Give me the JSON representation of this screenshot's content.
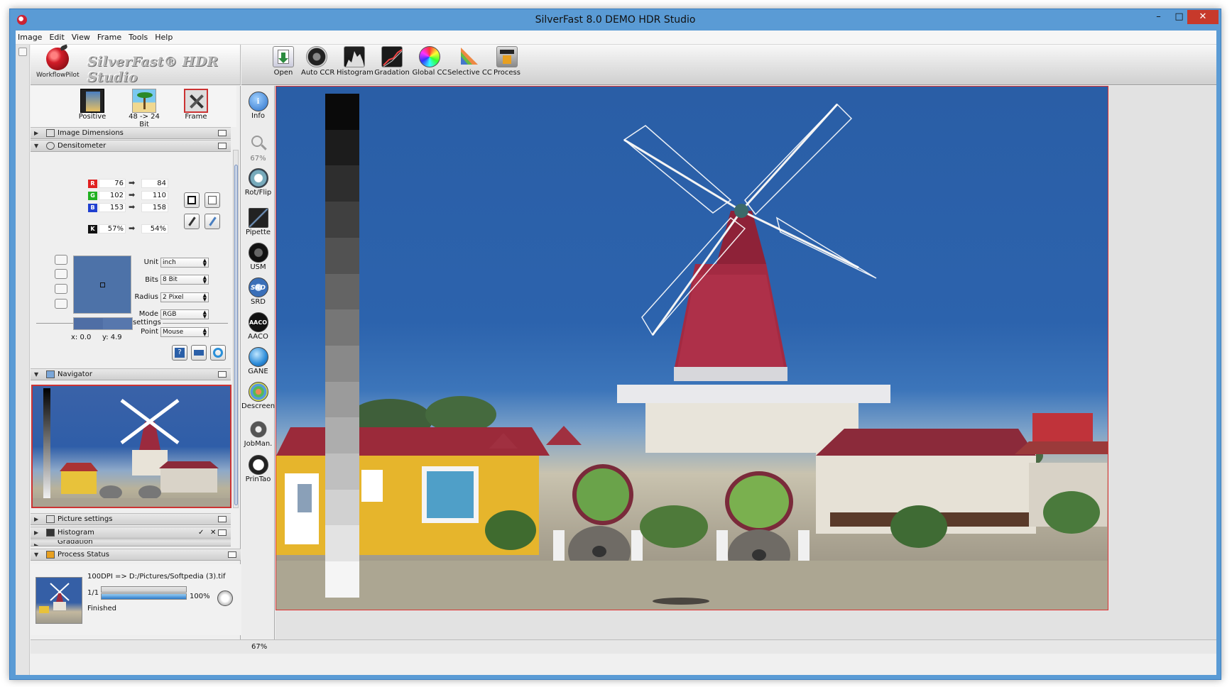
{
  "window": {
    "title": "SilverFast 8.0 DEMO  HDR Studio"
  },
  "menu": [
    "Image",
    "Edit",
    "View",
    "Frame",
    "Tools",
    "Help"
  ],
  "logo": {
    "workflow_pilot": "WorkflowPilot",
    "brand": "SilverFast® HDR Studio"
  },
  "toolbar": [
    {
      "label": "Open",
      "icon": "open-icon"
    },
    {
      "label": "Auto CCR",
      "icon": "auto-ccr-icon"
    },
    {
      "label": "Histogram",
      "icon": "histogram-icon"
    },
    {
      "label": "Gradation",
      "icon": "gradation-icon"
    },
    {
      "label": "Global CC",
      "icon": "global-cc-icon"
    },
    {
      "label": "Selective CC",
      "icon": "selective-cc-icon"
    },
    {
      "label": "Process",
      "icon": "process-icon"
    }
  ],
  "quick": [
    {
      "label": "Positive",
      "icon": "film-icon"
    },
    {
      "label": "48 -> 24 Bit",
      "icon": "beach-icon"
    },
    {
      "label": "Frame",
      "icon": "frame-tools-icon"
    }
  ],
  "sections": {
    "image_dimensions": "Image Dimensions",
    "densitometer": "Densitometer",
    "navigator": "Navigator",
    "picture_settings": "Picture settings",
    "histogram": "Histogram",
    "gradation": "Gradation",
    "process_status": "Process Status"
  },
  "densitometer": {
    "rows": [
      {
        "ch": "R",
        "color": "#e02020",
        "in": "76",
        "out": "84"
      },
      {
        "ch": "G",
        "color": "#20b020",
        "in": "102",
        "out": "110"
      },
      {
        "ch": "B",
        "color": "#2040d0",
        "in": "153",
        "out": "158"
      }
    ],
    "k": {
      "ch": "K",
      "in": "57%",
      "out": "54%"
    },
    "expert": "Expert settings",
    "fields": [
      {
        "label": "Unit",
        "value": "inch"
      },
      {
        "label": "Bits",
        "value": "8 Bit"
      },
      {
        "label": "Radius",
        "value": "2 Pixel"
      },
      {
        "label": "Mode",
        "value": "RGB"
      },
      {
        "label": "Point",
        "value": "Mouse"
      }
    ],
    "x": "x: 0.0",
    "y": "y: 4.9",
    "swatch_color": "#4d72a8"
  },
  "vstrip": [
    {
      "label": "Info",
      "icon": "info-icon"
    },
    {
      "label": "67%",
      "icon": "zoom-icon"
    },
    {
      "label": "Rot/Flip",
      "icon": "rotate-flip-icon"
    },
    {
      "label": "Pipette",
      "icon": "pipette-icon"
    },
    {
      "label": "USM",
      "icon": "usm-icon"
    },
    {
      "label": "SRD",
      "icon": "srd-icon"
    },
    {
      "label": "AACO",
      "icon": "aaco-icon"
    },
    {
      "label": "GANE",
      "icon": "gane-icon"
    },
    {
      "label": "Descreen",
      "icon": "descreen-icon"
    },
    {
      "label": "JobMan.",
      "icon": "jobmanager-icon"
    },
    {
      "label": "PrinTao",
      "icon": "printao-icon"
    }
  ],
  "process_status": {
    "line1": "100DPI => D:/Pictures/Softpedia (3).tif",
    "count": "1/1",
    "percent": "100%",
    "progress": 1.0,
    "status": "Finished"
  },
  "statusbar": {
    "zoom": "67%"
  },
  "canvas": {
    "corner_marker": "1"
  }
}
